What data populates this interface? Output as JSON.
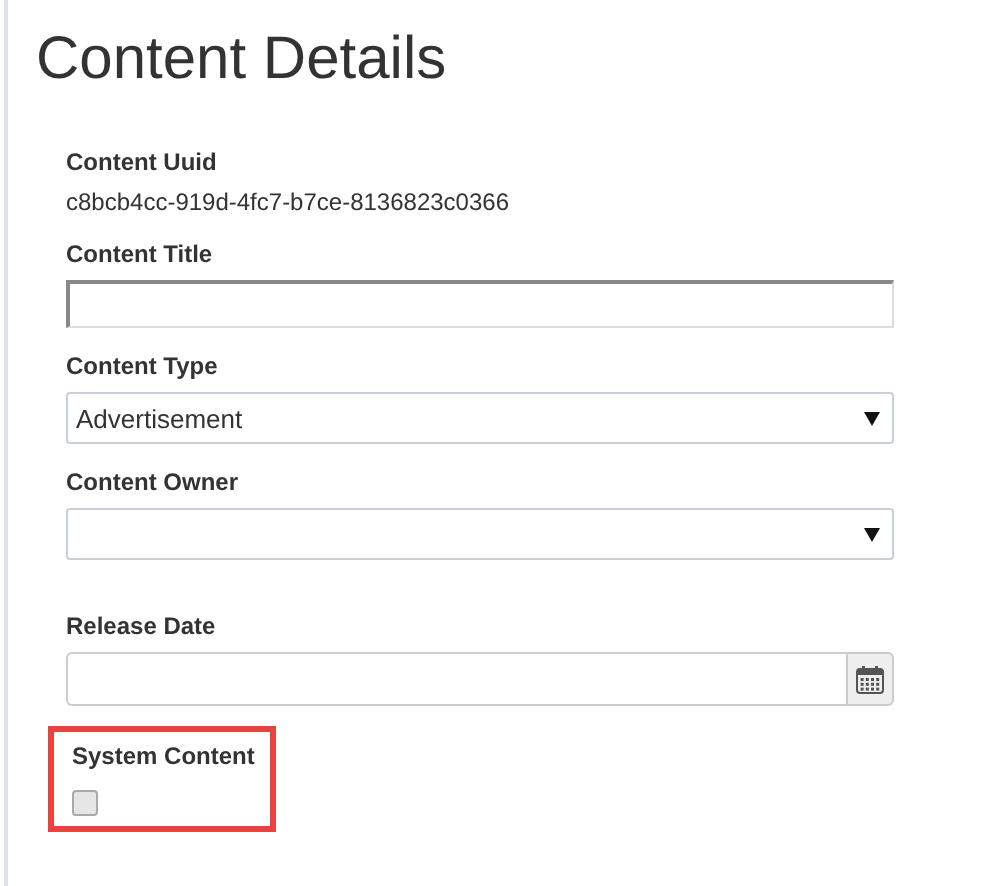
{
  "page_title": "Content Details",
  "fields": [
    {
      "kind": "static",
      "label": "Content Uuid",
      "value": "c8bcb4cc-919d-4fc7-b7ce-8136823c0366"
    },
    {
      "kind": "text",
      "label": "Content Title",
      "focused": true
    },
    {
      "kind": "select",
      "label": "Content Type",
      "value": "Advertisement"
    },
    {
      "kind": "select",
      "label": "Content Owner"
    },
    {
      "kind": "date",
      "label": "Release Date"
    },
    {
      "kind": "checkbox",
      "label": "System Content",
      "checked": false,
      "highlighted": true
    }
  ]
}
